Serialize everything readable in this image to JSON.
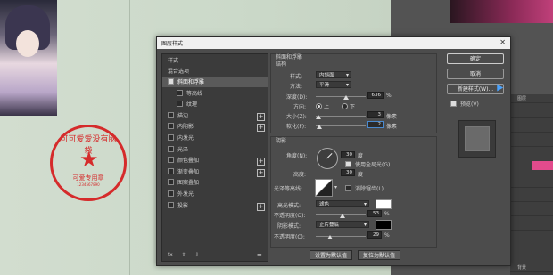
{
  "dialog": {
    "title": "图层样式",
    "close": "✕"
  },
  "left_list": {
    "header": "样式",
    "blend_options": "混合选项",
    "items": [
      {
        "label": "斜面和浮雕",
        "checked": true,
        "selected": true,
        "plus": false,
        "sub": false
      },
      {
        "label": "等高线",
        "checked": false,
        "selected": false,
        "plus": false,
        "sub": true
      },
      {
        "label": "纹理",
        "checked": false,
        "selected": false,
        "plus": false,
        "sub": true
      },
      {
        "label": "描边",
        "checked": false,
        "selected": false,
        "plus": true,
        "sub": false
      },
      {
        "label": "内阴影",
        "checked": false,
        "selected": false,
        "plus": true,
        "sub": false
      },
      {
        "label": "内发光",
        "checked": false,
        "selected": false,
        "plus": false,
        "sub": false
      },
      {
        "label": "光泽",
        "checked": false,
        "selected": false,
        "plus": false,
        "sub": false
      },
      {
        "label": "颜色叠加",
        "checked": false,
        "selected": false,
        "plus": true,
        "sub": false
      },
      {
        "label": "渐变叠加",
        "checked": false,
        "selected": false,
        "plus": true,
        "sub": false
      },
      {
        "label": "图案叠加",
        "checked": false,
        "selected": false,
        "plus": false,
        "sub": false
      },
      {
        "label": "外发光",
        "checked": false,
        "selected": false,
        "plus": false,
        "sub": false
      },
      {
        "label": "投影",
        "checked": false,
        "selected": false,
        "plus": true,
        "sub": false
      }
    ],
    "bottom": {
      "fx": "fx",
      "up": "⇧",
      "down": "⇩",
      "trash": "🗑"
    }
  },
  "bevel": {
    "section": "斜面和浮雕",
    "structure": "结构",
    "style_label": "样式:",
    "style_value": "内斜面",
    "technique_label": "方法:",
    "technique_value": "平滑",
    "depth_label": "深度(D):",
    "depth_value": "636",
    "depth_unit": "%",
    "depth_level": 0.6,
    "direction_label": "方向:",
    "dir_up": "上",
    "dir_down": "下",
    "size_label": "大小(Z):",
    "size_value": "3",
    "size_unit": "像素",
    "size_level": 0.05,
    "soften_label": "软化(F):",
    "soften_value": "2",
    "soften_unit": "像素",
    "soften_level": 0.08
  },
  "shading": {
    "section": "阴影",
    "angle_label": "角度(N):",
    "angle_value": "30",
    "angle_unit": "度",
    "global_light": "使用全局光(G)",
    "altitude_label": "高度:",
    "altitude_value": "30",
    "altitude_unit": "度",
    "gloss_label": "光泽等高线:",
    "antialias": "消除锯齿(L)",
    "highlight_label": "高光模式:",
    "highlight_mode": "滤色",
    "highlight_color": "#ffffff",
    "hl_opacity_label": "不透明度(O):",
    "hl_opacity_value": "53",
    "hl_opacity_unit": "%",
    "hl_opacity_level": 0.53,
    "shadow_label": "阴影模式:",
    "shadow_mode": "正片叠底",
    "shadow_color": "#000000",
    "sh_opacity_label": "不透明度(C):",
    "sh_opacity_value": "29",
    "sh_opacity_unit": "%",
    "sh_opacity_level": 0.29
  },
  "buttons": {
    "set_default": "设置为默认值",
    "reset_default": "复位为默认值",
    "ok": "确定",
    "cancel": "取消",
    "new_style": "新建样式(W)...",
    "preview": "预览(V)"
  },
  "seal": {
    "ring_text": "可可爱爱没有脑袋",
    "bottom_text": "可爱专用章",
    "number": "1234567890"
  },
  "ps_panel": {
    "layers_tab": "图层",
    "layer_name": "背景"
  }
}
